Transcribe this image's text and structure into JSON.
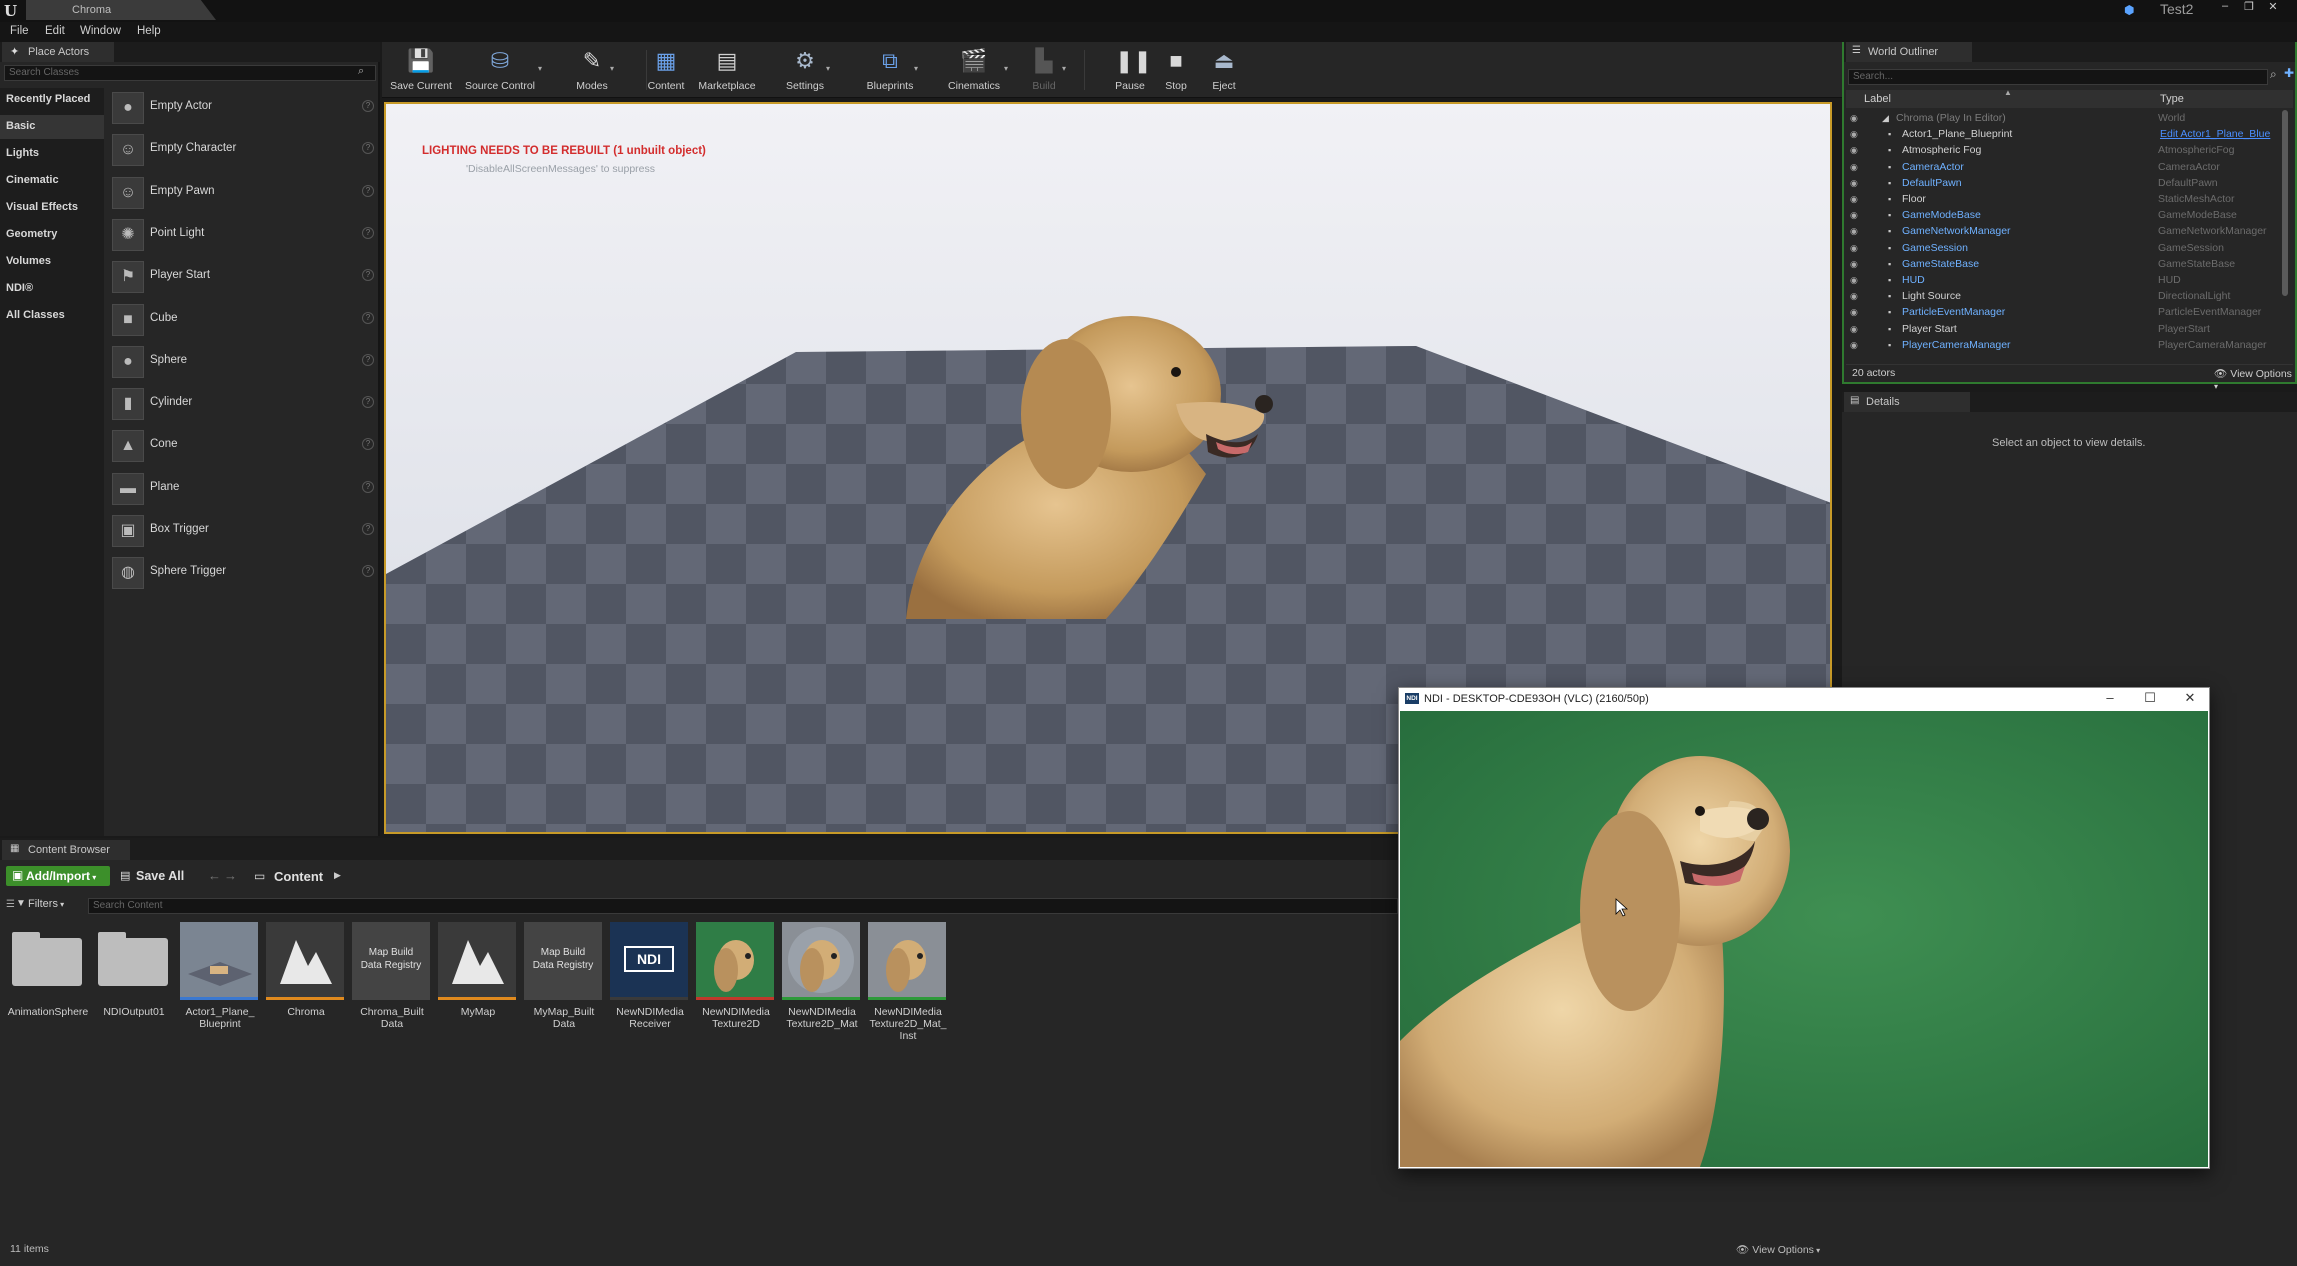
{
  "app": {
    "doc_tab": "Chroma",
    "project": "Test2",
    "window_controls": [
      "–",
      "❐",
      "✕"
    ]
  },
  "menu": [
    "File",
    "Edit",
    "Window",
    "Help"
  ],
  "place_actors": {
    "tab": "Place Actors",
    "search_placeholder": "Search Classes",
    "categories": [
      {
        "label": "Recently Placed",
        "selected": false
      },
      {
        "label": "Basic",
        "selected": true
      },
      {
        "label": "Lights",
        "selected": false
      },
      {
        "label": "Cinematic",
        "selected": false
      },
      {
        "label": "Visual Effects",
        "selected": false
      },
      {
        "label": "Geometry",
        "selected": false
      },
      {
        "label": "Volumes",
        "selected": false
      },
      {
        "label": "NDI®",
        "selected": false
      },
      {
        "label": "All Classes",
        "selected": false
      }
    ],
    "actors": [
      "Empty Actor",
      "Empty Character",
      "Empty Pawn",
      "Point Light",
      "Player Start",
      "Cube",
      "Sphere",
      "Cylinder",
      "Cone",
      "Plane",
      "Box Trigger",
      "Sphere Trigger"
    ],
    "help_glyph": "?"
  },
  "toolbar": {
    "buttons": [
      {
        "label": "Save Current",
        "icon": "save-icon"
      },
      {
        "label": "Source Control",
        "icon": "source-control-icon"
      },
      {
        "label": "Modes",
        "icon": "modes-icon"
      },
      {
        "label": "Content",
        "icon": "content-icon"
      },
      {
        "label": "Marketplace",
        "icon": "marketplace-icon"
      },
      {
        "label": "Settings",
        "icon": "settings-icon"
      },
      {
        "label": "Blueprints",
        "icon": "blueprints-icon"
      },
      {
        "label": "Cinematics",
        "icon": "cinematics-icon"
      },
      {
        "label": "Build",
        "icon": "build-icon"
      },
      {
        "label": "Pause",
        "icon": "pause-icon"
      },
      {
        "label": "Stop",
        "icon": "stop-icon"
      },
      {
        "label": "Eject",
        "icon": "eject-icon"
      }
    ]
  },
  "viewport": {
    "warning": "LIGHTING NEEDS TO BE REBUILT (1 unbuilt object)",
    "hint": "'DisableAllScreenMessages' to suppress"
  },
  "world_outliner": {
    "tab": "World Outliner",
    "search_placeholder": "Search...",
    "col_label": "Label",
    "col_type": "Type",
    "rows": [
      {
        "label": "Chroma (Play In Editor)",
        "type": "World",
        "style": "dim",
        "indent": 1
      },
      {
        "label": "Actor1_Plane_Blueprint",
        "type": "Edit Actor1_Plane_Blue",
        "style": "normal",
        "type_link": true,
        "indent": 2
      },
      {
        "label": "Atmospheric Fog",
        "type": "AtmosphericFog",
        "style": "normal",
        "indent": 2
      },
      {
        "label": "CameraActor",
        "type": "CameraActor",
        "style": "blue",
        "indent": 2
      },
      {
        "label": "DefaultPawn",
        "type": "DefaultPawn",
        "style": "blue",
        "indent": 2
      },
      {
        "label": "Floor",
        "type": "StaticMeshActor",
        "style": "normal",
        "indent": 2
      },
      {
        "label": "GameModeBase",
        "type": "GameModeBase",
        "style": "blue",
        "indent": 2
      },
      {
        "label": "GameNetworkManager",
        "type": "GameNetworkManager",
        "style": "blue",
        "indent": 2
      },
      {
        "label": "GameSession",
        "type": "GameSession",
        "style": "blue",
        "indent": 2
      },
      {
        "label": "GameStateBase",
        "type": "GameStateBase",
        "style": "blue",
        "indent": 2
      },
      {
        "label": "HUD",
        "type": "HUD",
        "style": "blue",
        "indent": 2
      },
      {
        "label": "Light Source",
        "type": "DirectionalLight",
        "style": "normal",
        "indent": 2
      },
      {
        "label": "ParticleEventManager",
        "type": "ParticleEventManager",
        "style": "blue",
        "indent": 2
      },
      {
        "label": "Player Start",
        "type": "PlayerStart",
        "style": "normal",
        "indent": 2
      },
      {
        "label": "PlayerCameraManager",
        "type": "PlayerCameraManager",
        "style": "blue",
        "indent": 2
      }
    ],
    "count": "20 actors",
    "view_options": "View Options"
  },
  "details": {
    "tab": "Details",
    "message": "Select an object to view details."
  },
  "content_browser": {
    "tab": "Content Browser",
    "add_import": "Add/Import",
    "save_all": "Save All",
    "path": "Content",
    "filters": "Filters",
    "search_placeholder": "Search Content",
    "assets": [
      {
        "label": "AnimationSphere",
        "kind": "folder"
      },
      {
        "label": "NDIOutput01",
        "kind": "folder"
      },
      {
        "label": "Actor1_Plane_\nBlueprint",
        "kind": "blueprint"
      },
      {
        "label": "Chroma",
        "kind": "map"
      },
      {
        "label": "Chroma_Built\nData",
        "kind": "registry",
        "thumb_text": "Map Build\nData Registry"
      },
      {
        "label": "MyMap",
        "kind": "map"
      },
      {
        "label": "MyMap_Built\nData",
        "kind": "registry",
        "thumb_text": "Map Build\nData Registry"
      },
      {
        "label": "NewNDIMedia\nReceiver",
        "kind": "ndi"
      },
      {
        "label": "NewNDIMedia\nTexture2D",
        "kind": "dog"
      },
      {
        "label": "NewNDIMedia\nTexture2D_Mat",
        "kind": "dog-sphere"
      },
      {
        "label": "NewNDIMedia\nTexture2D_Mat_\nInst",
        "kind": "dog-check"
      }
    ],
    "count": "11 items",
    "view_options": "View Options"
  },
  "ndi_window": {
    "logo": "NDI",
    "title": "NDI - DESKTOP-CDE93OH (VLC) (2160/50p)",
    "controls": [
      "–",
      "☐",
      "✕"
    ]
  }
}
